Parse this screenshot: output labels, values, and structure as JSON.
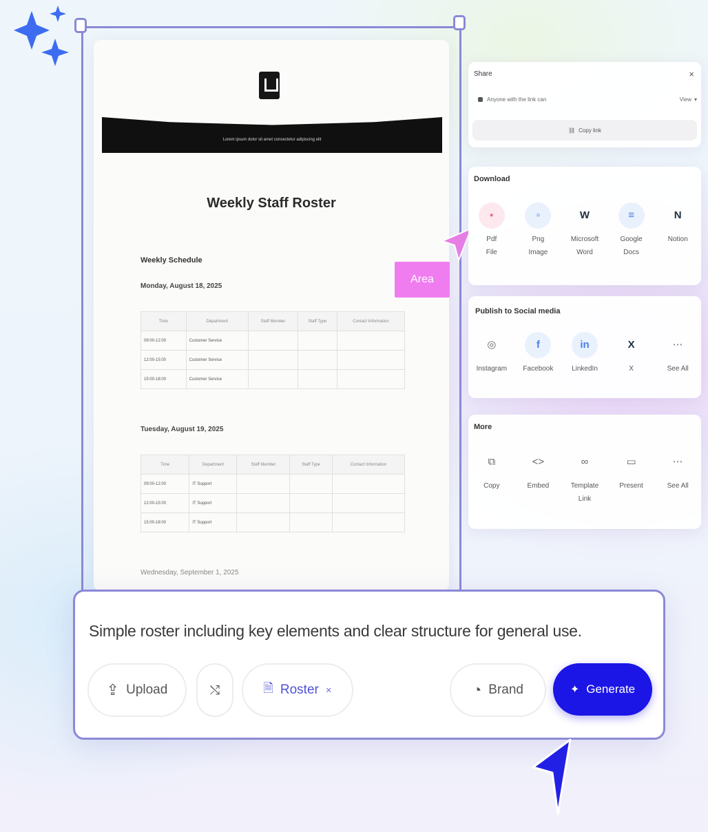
{
  "document": {
    "banner_text": "Lorem ipsum dolor sit amet consectetur adipiscing elit",
    "title": "Weekly Staff Roster",
    "section_heading": "Weekly Schedule",
    "day1": "Monday, August 18, 2025",
    "day2": "Tuesday, August 19, 2025",
    "day3": "Wednesday, September 1, 2025",
    "table1": {
      "headers": [
        "Time",
        "Department",
        "Staff Member",
        "Staff Type",
        "Contact Information"
      ],
      "rows": [
        [
          "09:00-12:00",
          "Customer Service",
          "",
          "",
          ""
        ],
        [
          "12:00-15:00",
          "Customer Service",
          "",
          "",
          ""
        ],
        [
          "15:00-18:00",
          "Customer Service",
          "",
          "",
          ""
        ]
      ]
    },
    "table2": {
      "headers": [
        "Time",
        "Department",
        "Staff Member",
        "Staff Type",
        "Contact Information"
      ],
      "rows": [
        [
          "09:00-12:00",
          "IT Support",
          "",
          "",
          ""
        ],
        [
          "12:00-15:00",
          "IT Support",
          "",
          "",
          ""
        ],
        [
          "15:00-18:00",
          "IT Support",
          "",
          "",
          ""
        ]
      ]
    }
  },
  "area_tag": "Area",
  "share_panel": {
    "title": "Share",
    "close_label": "×",
    "access_text": "Anyone with the link can",
    "access_level": "View",
    "copy_link_label": "Copy link"
  },
  "download_panel": {
    "title": "Download",
    "items": [
      {
        "line1": "Pdf",
        "line2": "File",
        "glyph": "▪"
      },
      {
        "line1": "Png",
        "line2": "Image",
        "glyph": "▫"
      },
      {
        "line1": "Microsoft",
        "line2": "Word",
        "glyph": "W"
      },
      {
        "line1": "Google",
        "line2": "Docs",
        "glyph": "≡"
      },
      {
        "line1": "Notion",
        "line2": "",
        "glyph": "N"
      }
    ]
  },
  "social_panel": {
    "title": "Publish to Social media",
    "items": [
      {
        "label": "Instagram",
        "glyph": "◎"
      },
      {
        "label": "Facebook",
        "glyph": "f"
      },
      {
        "label": "LinkedIn",
        "glyph": "in"
      },
      {
        "label": "X",
        "glyph": "X"
      },
      {
        "label": "See All",
        "glyph": "⋯"
      }
    ]
  },
  "more_panel": {
    "title": "More",
    "items": [
      {
        "line1": "Copy",
        "line2": "",
        "glyph": "⧉"
      },
      {
        "line1": "Embed",
        "line2": "",
        "glyph": "<>"
      },
      {
        "line1": "Template",
        "line2": "Link",
        "glyph": "∞"
      },
      {
        "line1": "Present",
        "line2": "",
        "glyph": "▭"
      },
      {
        "line1": "See All",
        "line2": "",
        "glyph": "⋯"
      }
    ]
  },
  "prompt": {
    "text": "Simple roster including key elements and clear structure for general use.",
    "upload_label": "Upload",
    "roster_label": "Roster",
    "brand_label": "Brand",
    "generate_label": "Generate"
  },
  "colors": {
    "accent": "#1b15e6",
    "frame": "#8a89d6",
    "area_tag": "#f07df0",
    "sparkle": "#3d6cf0"
  }
}
